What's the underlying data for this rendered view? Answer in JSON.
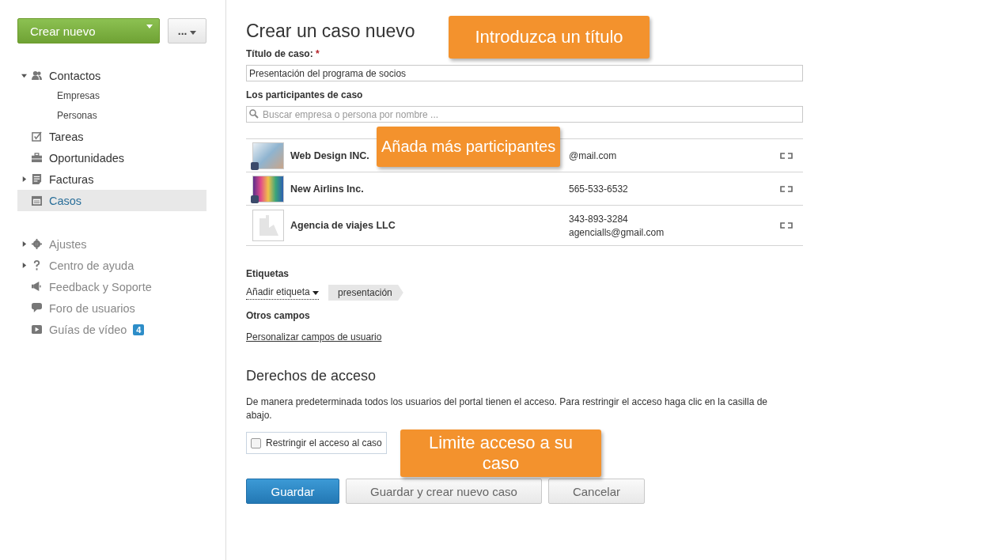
{
  "sidebar": {
    "create_button": "Crear nuevo",
    "more_button": "...",
    "nav": [
      {
        "label": "Contactos",
        "kind": "expandable",
        "expanded": true,
        "selected": false,
        "children": [
          {
            "label": "Empresas"
          },
          {
            "label": "Personas"
          }
        ]
      },
      {
        "label": "Tareas",
        "kind": "plain",
        "selected": false
      },
      {
        "label": "Oportunidades",
        "kind": "plain",
        "selected": false
      },
      {
        "label": "Facturas",
        "kind": "expandable",
        "expanded": false,
        "selected": false
      },
      {
        "label": "Casos",
        "kind": "plain",
        "selected": true
      }
    ],
    "secondary": [
      {
        "label": "Ajustes",
        "kind": "expandable",
        "expanded": false
      },
      {
        "label": "Centro de ayuda",
        "kind": "expandable",
        "expanded": false
      },
      {
        "label": "Feedback y Soporte",
        "kind": "plain"
      },
      {
        "label": "Foro de usuarios",
        "kind": "plain"
      },
      {
        "label": "Guías de vídeo",
        "kind": "plain",
        "badge": "4"
      }
    ]
  },
  "form": {
    "title": "Crear un caso nuevo",
    "case_title_label": "Título de caso:",
    "required_mark": "*",
    "case_title_value": "Presentación del programa de socios",
    "participants_label": "Los participantes de caso",
    "search": {
      "placeholder": "Buscar empresa o persona por nombre ..."
    },
    "participants": [
      {
        "name": "Web Design INC.",
        "kind": "photo",
        "contact": [
          "@mail.com"
        ]
      },
      {
        "name": "New Airlins Inc.",
        "kind": "photo",
        "contact": [
          "565-533-6532"
        ]
      },
      {
        "name": "Agencia de viajes LLC",
        "kind": "placeholder",
        "contact": [
          "343-893-3284",
          "agencialls@gmail.com"
        ]
      }
    ],
    "tags_label": "Etiquetas",
    "add_tag": "Añadir etiqueta",
    "tags": [
      "presentación"
    ],
    "other_fields_label": "Otros campos",
    "customize_link": "Personalizar campos de usuario",
    "access_title": "Derechos de acceso",
    "access_text": "De manera predeterminada todos los usuarios del portal tienen el acceso. Para restringir el acceso haga clic en la casilla de abajo.",
    "restrict": {
      "label": "Restringir el acceso al caso",
      "checked": false
    },
    "buttons": [
      {
        "label": "Guardar",
        "kind": "primary"
      },
      {
        "label": "Guardar y crear nuevo caso",
        "kind": "secondary"
      },
      {
        "label": "Cancelar",
        "kind": "secondary"
      }
    ]
  },
  "callouts": [
    {
      "text": "Introduzca un título"
    },
    {
      "text": "Añada más participantes"
    },
    {
      "text": "Limite acceso a su caso"
    }
  ]
}
